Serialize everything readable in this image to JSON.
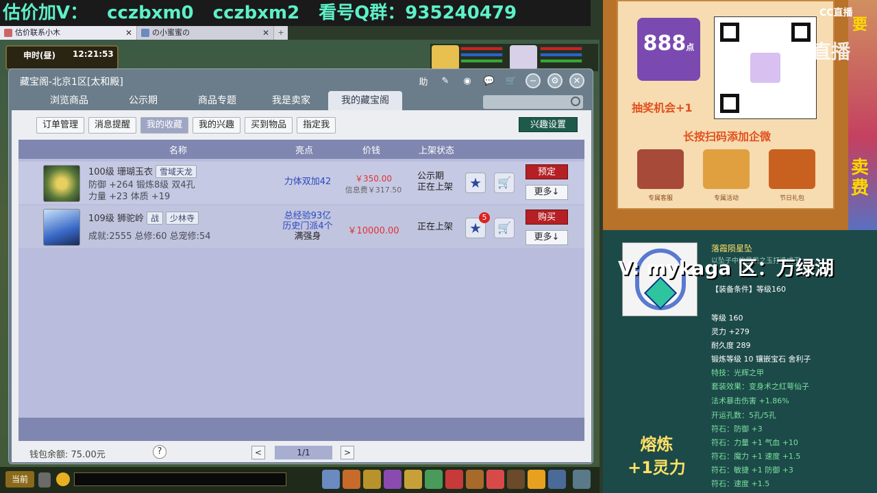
{
  "banner": {
    "part1": "估价加V：",
    "part2": "cczbxm0",
    "part3": "cczbxm2",
    "part4": "看号Q群：935240479"
  },
  "browser_tabs": [
    {
      "label": "估价联系小木"
    },
    {
      "label": "の小蜜蜜の"
    }
  ],
  "game_hud": {
    "time_label": "申时(昼)",
    "clock": "12:21:53"
  },
  "window": {
    "title": "藏宝阁-北京1区[太和殿]",
    "icons": [
      "help-icon",
      "pencil-icon",
      "record-icon",
      "chat-icon",
      "cart-icon",
      "minimize-icon",
      "settings-icon",
      "close-icon"
    ],
    "help_glyph": "助"
  },
  "nav_tabs": [
    "浏览商品",
    "公示期",
    "商品专题",
    "我是卖家",
    "我的藏宝阁"
  ],
  "sub_tabs": [
    "订单管理",
    "消息提醒",
    "我的收藏",
    "我的兴趣",
    "买到物品",
    "指定我"
  ],
  "interest_button": "兴趣设置",
  "table": {
    "headers": {
      "name": "名称",
      "highlight": "亮点",
      "price": "价钱",
      "status": "上架状态"
    },
    "rows": [
      {
        "level_name": "100级  珊瑚玉衣",
        "tag": "雪域天龙",
        "line2": "防御 +264 锻炼8级 双4孔",
        "line3": "力量 +23 体质 +19",
        "highlight1": "力体双加42",
        "price": "￥350.00",
        "deposit": "信息费￥317.50",
        "status1": "公示期",
        "status2": "正在上架",
        "button": "预定",
        "more": "更多↓"
      },
      {
        "level_name": "109级  狮驼岭",
        "tag_badge": "战",
        "tag": "少林寺",
        "line2": "成就:2555 总修:60 总宠修:54",
        "highlight1": "总经验93亿",
        "highlight2": "历史门派4个",
        "highlight3": "满强身",
        "price": "￥10000.00",
        "status1": "正在上架",
        "badge": "5",
        "button": "购买",
        "more": "更多↓"
      }
    ]
  },
  "footer": {
    "wallet": "钱包余额: 75.00元",
    "help": "?",
    "page": "1/1",
    "prev": "<",
    "next": ">"
  },
  "gamebar": {
    "current": "当前"
  },
  "promo": {
    "number": "888",
    "unit": "点",
    "lottery": "抽奖机会+1",
    "scan": "长按扫码添加企微",
    "items": [
      "专属客服",
      "专属活动",
      "节日礼包"
    ]
  },
  "cc_logo": "CC直播",
  "cc_watermark": "CC直播",
  "right_sell": "卖\n费",
  "right_top": "要",
  "item": {
    "name": "落霞陨星坠",
    "desc": "以坠子中的星辰之玉打造成玉,",
    "vline": "V: mykaga  区：万绿湖",
    "requirement": "【装备条件】等级160",
    "stats": [
      {
        "text": "等级 160",
        "c": "w"
      },
      {
        "text": "灵力 +279",
        "c": "w"
      },
      {
        "text": "耐久度 289",
        "c": "w"
      },
      {
        "text": "锻炼等级 10  镶嵌宝石 舍利子",
        "c": "w"
      },
      {
        "text": "特技：光辉之甲",
        "c": "g"
      },
      {
        "text": "套装效果：变身术之红萼仙子",
        "c": "g"
      },
      {
        "text": "法术暴击伤害 +1.86%",
        "c": "g"
      },
      {
        "text": "开运孔数：5孔/5孔",
        "c": "g"
      },
      {
        "text": "符石：防御 +3",
        "c": "g"
      },
      {
        "text": "符石：力量 +1 气血 +10",
        "c": "g"
      },
      {
        "text": "符石：魔力 +1 速度 +1.5",
        "c": "g"
      },
      {
        "text": "符石：敏捷 +1 防御 +3",
        "c": "g"
      },
      {
        "text": "符石：速度 +1.5",
        "c": "g"
      }
    ],
    "smelt": "熔炼\n+1灵力"
  }
}
